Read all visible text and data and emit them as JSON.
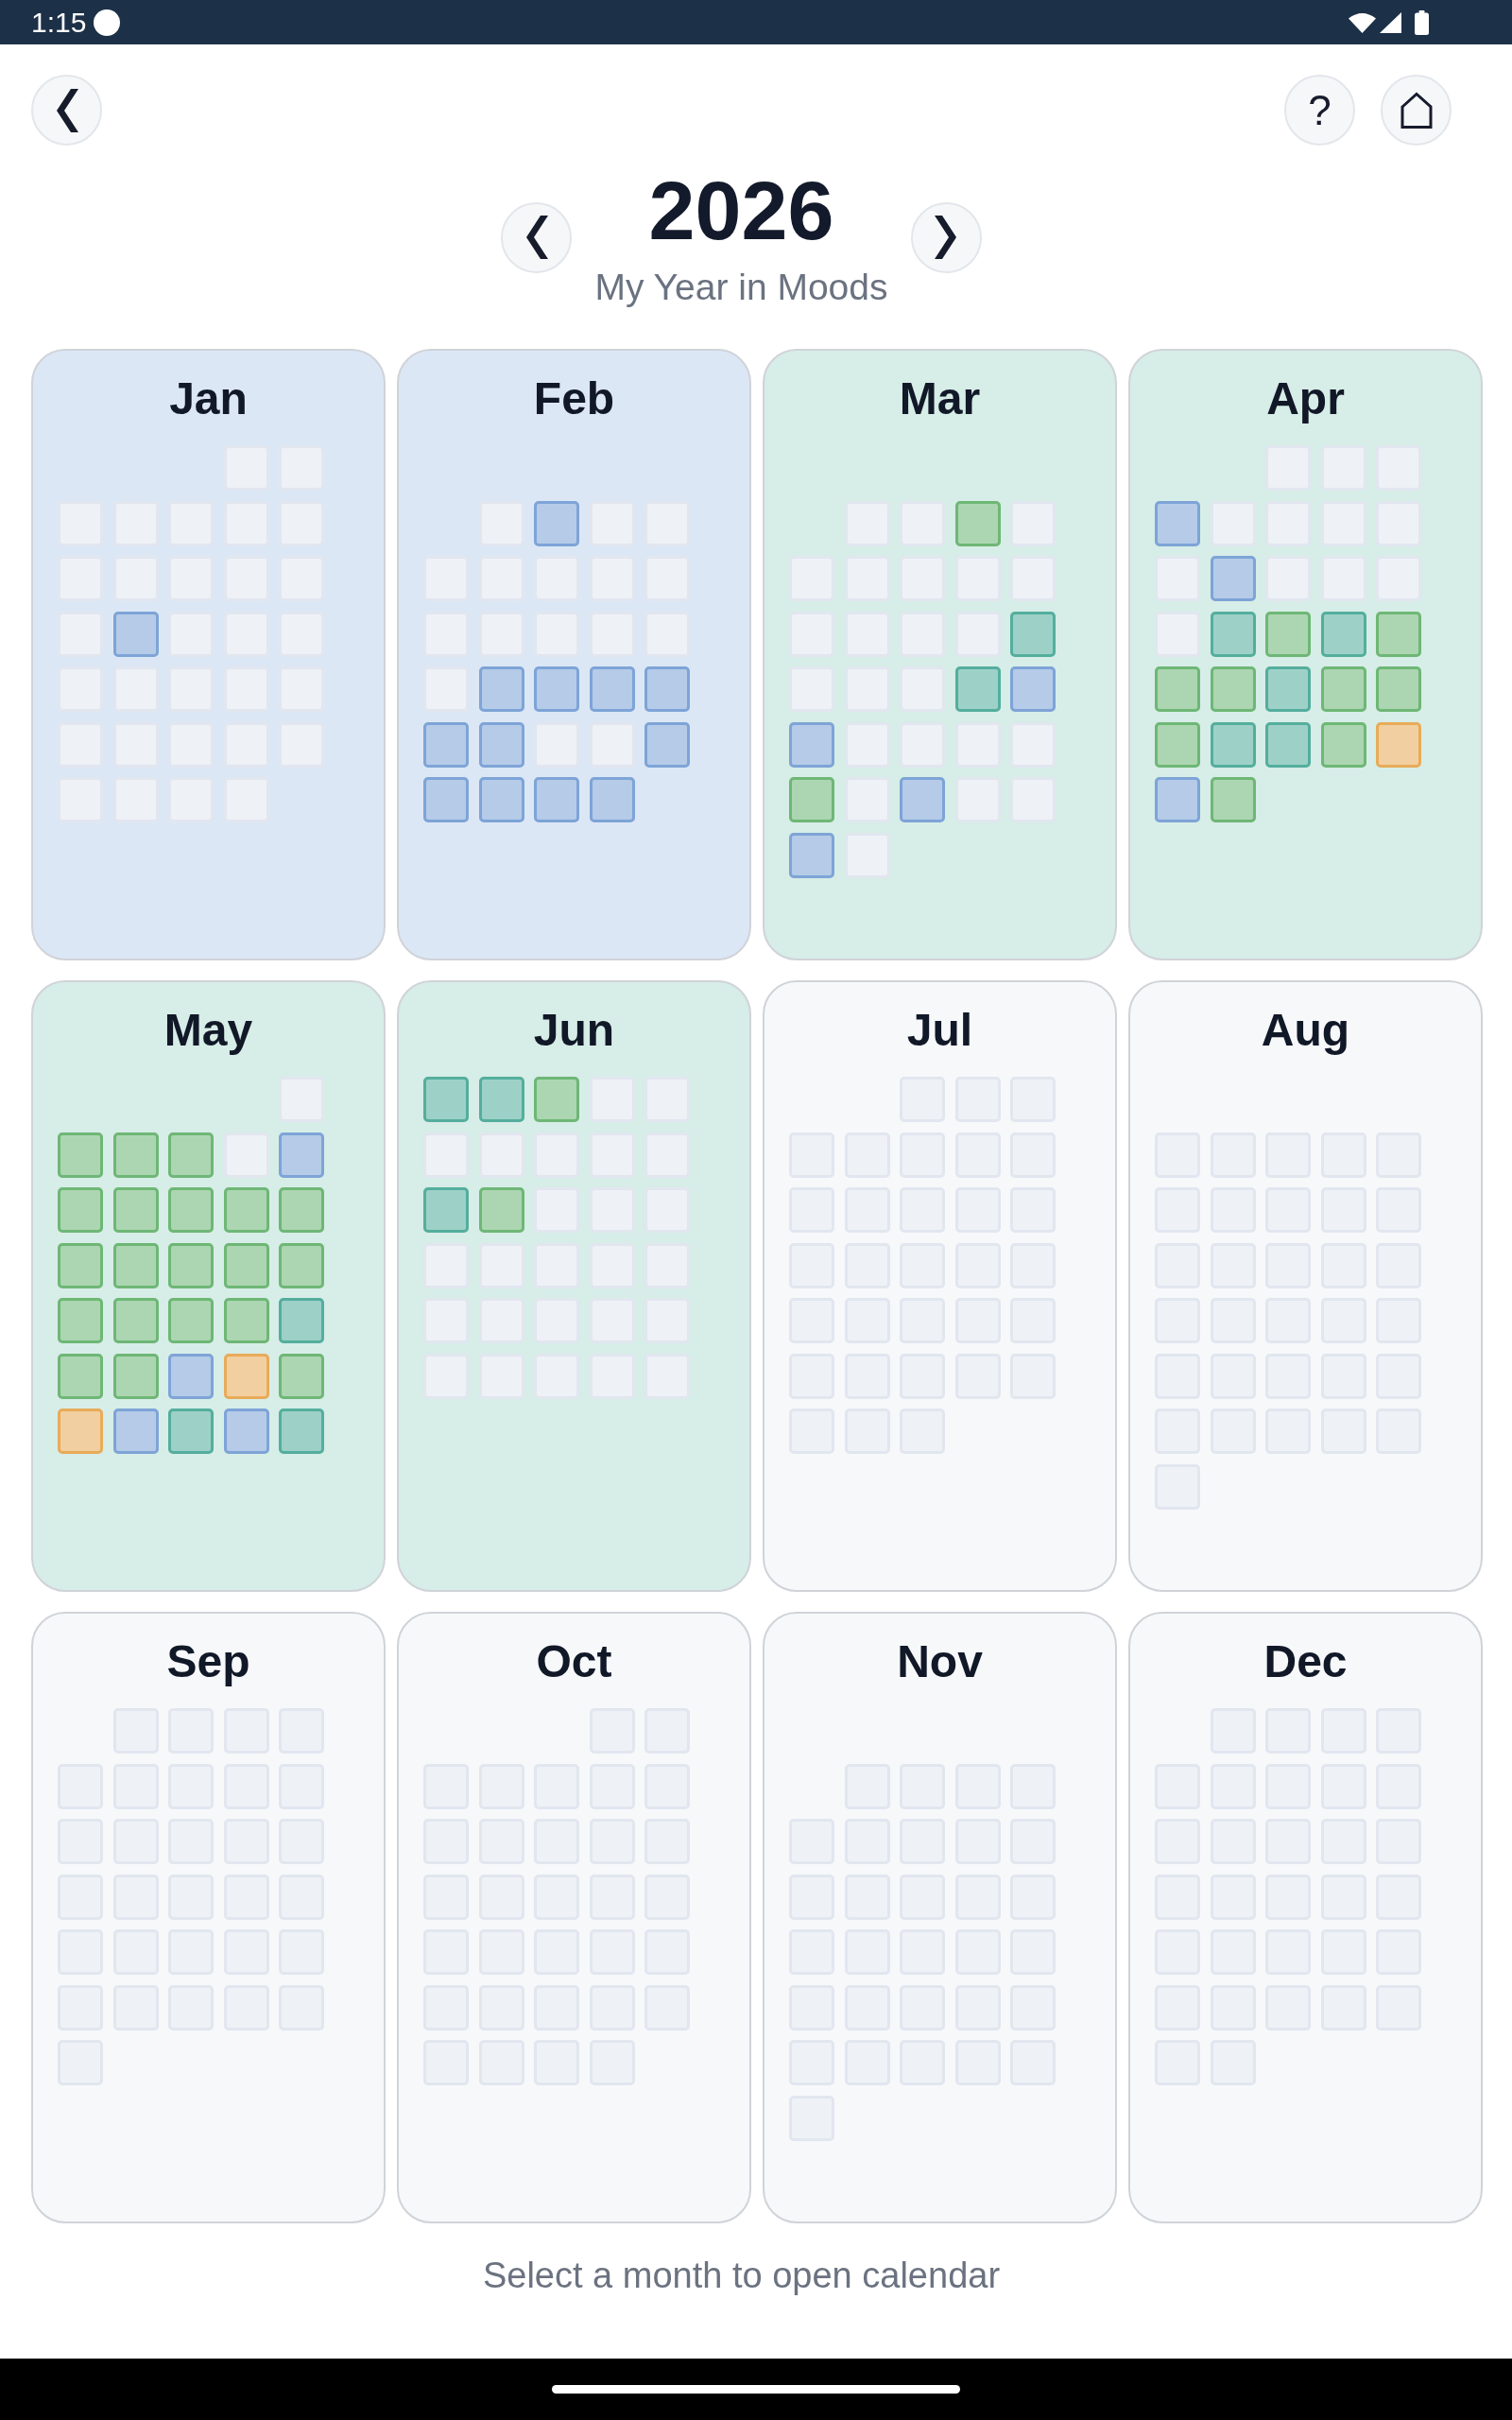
{
  "status_bar": {
    "time": "1:15"
  },
  "top_bar": {
    "help_button": "?"
  },
  "year_selector": {
    "year": "2026",
    "subtitle": "My Year in Moods"
  },
  "months": [
    {
      "name": "Jan",
      "color": "#dce7f6",
      "rows": [
        [
          null,
          null,
          null,
          {
            "color": "#eef1f6"
          },
          {
            "color": "#eef1f6"
          }
        ],
        [
          {
            "color": "#eef1f6"
          },
          {
            "color": "#eef1f6"
          },
          {
            "color": "#eef1f6"
          },
          {
            "color": "#eef1f6"
          },
          {
            "color": "#eef1f6"
          }
        ],
        [
          {
            "color": "#eef1f6"
          },
          {
            "color": "#eef1f6"
          },
          {
            "color": "#eef1f6"
          },
          {
            "color": "#eef1f6"
          },
          {
            "color": "#eef1f6"
          }
        ],
        [
          {
            "color": "#eef1f6"
          },
          {
            "color": "#b5cbe8"
          },
          {
            "color": "#eef1f6"
          },
          {
            "color": "#eef1f6"
          },
          {
            "color": "#eef1f6"
          }
        ],
        [
          {
            "color": "#eef1f6"
          },
          {
            "color": "#eef1f6"
          },
          {
            "color": "#eef1f6"
          },
          {
            "color": "#eef1f6"
          },
          {
            "color": "#eef1f6"
          }
        ],
        [
          {
            "color": "#eef1f6"
          },
          {
            "color": "#eef1f6"
          },
          {
            "color": "#eef1f6"
          },
          {
            "color": "#eef1f6"
          },
          {
            "color": "#eef1f6"
          }
        ],
        [
          {
            "color": "#eef1f6"
          },
          {
            "color": "#eef1f6"
          },
          {
            "color": "#eef1f6"
          },
          {
            "color": "#eef1f6"
          }
        ]
      ]
    },
    {
      "name": "Feb",
      "color": "#dce7f6",
      "rows": [
        [
          null,
          null,
          null,
          null,
          null
        ],
        [
          null,
          {
            "color": "#eef1f6"
          },
          {
            "color": "#b5cbe8"
          },
          {
            "color": "#eef1f6"
          },
          {
            "color": "#eef1f6"
          }
        ],
        [
          {
            "color": "#eef1f6"
          },
          {
            "color": "#eef1f6"
          },
          {
            "color": "#eef1f6"
          },
          {
            "color": "#eef1f6"
          },
          {
            "color": "#eef1f6"
          }
        ],
        [
          {
            "color": "#eef1f6"
          },
          {
            "color": "#eef1f6"
          },
          {
            "color": "#eef1f6"
          },
          {
            "color": "#eef1f6"
          },
          {
            "color": "#eef1f6"
          }
        ],
        [
          {
            "color": "#eef1f6"
          },
          {
            "color": "#b5cbe8"
          },
          {
            "color": "#b5cbe8"
          },
          {
            "color": "#b5cbe8"
          },
          {
            "color": "#b5cbe8"
          }
        ],
        [
          {
            "color": "#b5cbe8"
          },
          {
            "color": "#b5cbe8"
          },
          {
            "color": "#eef1f6"
          },
          {
            "color": "#eef1f6"
          },
          {
            "color": "#b5cbe8"
          }
        ],
        [
          {
            "color": "#b5cbe8"
          },
          {
            "color": "#b5cbe8"
          },
          {
            "color": "#b5cbe8"
          },
          {
            "color": "#b5cbe8"
          }
        ]
      ]
    },
    {
      "name": "Mar",
      "color": "#d7ede7",
      "rows": [
        [
          null,
          null,
          null,
          null,
          null
        ],
        [
          null,
          {
            "color": "#eef1f6"
          },
          {
            "color": "#eef1f6"
          },
          {
            "color": "#acd6b1"
          },
          {
            "color": "#eef1f6"
          }
        ],
        [
          {
            "color": "#eef1f6"
          },
          {
            "color": "#eef1f6"
          },
          {
            "color": "#eef1f6"
          },
          {
            "color": "#eef1f6"
          },
          {
            "color": "#eef1f6"
          }
        ],
        [
          {
            "color": "#eef1f6"
          },
          {
            "color": "#eef1f6"
          },
          {
            "color": "#eef1f6"
          },
          {
            "color": "#eef1f6"
          },
          {
            "color": "#9dd1c7"
          }
        ],
        [
          {
            "color": "#eef1f6"
          },
          {
            "color": "#eef1f6"
          },
          {
            "color": "#eef1f6"
          },
          {
            "color": "#9dd1c7"
          },
          {
            "color": "#b5cbe8"
          }
        ],
        [
          {
            "color": "#b5cbe8"
          },
          {
            "color": "#eef1f6"
          },
          {
            "color": "#eef1f6"
          },
          {
            "color": "#eef1f6"
          },
          {
            "color": "#eef1f6"
          }
        ],
        [
          {
            "color": "#acd6b1"
          },
          {
            "color": "#eef1f6"
          },
          {
            "color": "#b5cbe8"
          },
          {
            "color": "#eef1f6"
          },
          {
            "color": "#eef1f6"
          }
        ],
        [
          {
            "color": "#b5cbe8"
          },
          {
            "color": "#eef1f6"
          }
        ]
      ]
    },
    {
      "name": "Apr",
      "color": "#d7ede7",
      "rows": [
        [
          null,
          null,
          {
            "color": "#eef1f6"
          },
          {
            "color": "#eef1f6"
          },
          {
            "color": "#eef1f6"
          }
        ],
        [
          {
            "color": "#b5cbe8"
          },
          {
            "color": "#eef1f6"
          },
          {
            "color": "#eef1f6"
          },
          {
            "color": "#eef1f6"
          },
          {
            "color": "#eef1f6"
          }
        ],
        [
          {
            "color": "#eef1f6"
          },
          {
            "color": "#b5cbe8"
          },
          {
            "color": "#eef1f6"
          },
          {
            "color": "#eef1f6"
          },
          {
            "color": "#eef1f6"
          }
        ],
        [
          {
            "color": "#eef1f6"
          },
          {
            "color": "#9dd1c7"
          },
          {
            "color": "#acd6b1"
          },
          {
            "color": "#9dd1c7"
          },
          {
            "color": "#acd6b1"
          }
        ],
        [
          {
            "color": "#acd6b1"
          },
          {
            "color": "#acd6b1"
          },
          {
            "color": "#9dd1c7"
          },
          {
            "color": "#acd6b1"
          },
          {
            "color": "#acd6b1"
          }
        ],
        [
          {
            "color": "#acd6b1"
          },
          {
            "color": "#9dd1c7"
          },
          {
            "color": "#9dd1c7"
          },
          {
            "color": "#acd6b1"
          },
          {
            "color": "#f2cfa0"
          }
        ],
        [
          {
            "color": "#b5cbe8"
          },
          {
            "color": "#acd6b1"
          }
        ]
      ]
    },
    {
      "name": "May",
      "color": "#d7ede7",
      "rows": [
        [
          null,
          null,
          null,
          null,
          {
            "color": "#eef1f6"
          }
        ],
        [
          {
            "color": "#acd6b1"
          },
          {
            "color": "#acd6b1"
          },
          {
            "color": "#acd6b1"
          },
          {
            "color": "#eef1f6"
          },
          {
            "color": "#b5cbe8"
          }
        ],
        [
          {
            "color": "#acd6b1"
          },
          {
            "color": "#acd6b1"
          },
          {
            "color": "#acd6b1"
          },
          {
            "color": "#acd6b1"
          },
          {
            "color": "#acd6b1"
          }
        ],
        [
          {
            "color": "#acd6b1"
          },
          {
            "color": "#acd6b1"
          },
          {
            "color": "#acd6b1"
          },
          {
            "color": "#acd6b1"
          },
          {
            "color": "#acd6b1"
          }
        ],
        [
          {
            "color": "#acd6b1"
          },
          {
            "color": "#acd6b1"
          },
          {
            "color": "#acd6b1"
          },
          {
            "color": "#acd6b1"
          },
          {
            "color": "#9dd1c7"
          }
        ],
        [
          {
            "color": "#acd6b1"
          },
          {
            "color": "#acd6b1"
          },
          {
            "color": "#b5cbe8"
          },
          {
            "color": "#f2cfa0"
          },
          {
            "color": "#acd6b1"
          }
        ],
        [
          {
            "color": "#f2cfa0"
          },
          {
            "color": "#b5cbe8"
          },
          {
            "color": "#9dd1c7"
          },
          {
            "color": "#b5cbe8"
          },
          {
            "color": "#9dd1c7"
          }
        ]
      ]
    },
    {
      "name": "Jun",
      "color": "#d7ede7",
      "rows": [
        [
          {
            "color": "#9dd1c7"
          },
          {
            "color": "#9dd1c7"
          },
          {
            "color": "#acd6b1"
          },
          {
            "color": "#eef1f6"
          },
          {
            "color": "#eef1f6"
          }
        ],
        [
          {
            "color": "#eef1f6"
          },
          {
            "color": "#eef1f6"
          },
          {
            "color": "#eef1f6"
          },
          {
            "color": "#eef1f6"
          },
          {
            "color": "#eef1f6"
          }
        ],
        [
          {
            "color": "#9dd1c7"
          },
          {
            "color": "#acd6b1"
          },
          {
            "color": "#eef1f6"
          },
          {
            "color": "#eef1f6"
          },
          {
            "color": "#eef1f6"
          }
        ],
        [
          {
            "color": "#eef1f6"
          },
          {
            "color": "#eef1f6"
          },
          {
            "color": "#eef1f6"
          },
          {
            "color": "#eef1f6"
          },
          {
            "color": "#eef1f6"
          }
        ],
        [
          {
            "color": "#eef1f6"
          },
          {
            "color": "#eef1f6"
          },
          {
            "color": "#eef1f6"
          },
          {
            "color": "#eef1f6"
          },
          {
            "color": "#eef1f6"
          }
        ],
        [
          {
            "color": "#eef1f6"
          },
          {
            "color": "#eef1f6"
          },
          {
            "color": "#eef1f6"
          },
          {
            "color": "#eef1f6"
          },
          {
            "color": "#eef1f6"
          }
        ]
      ]
    },
    {
      "name": "Jul",
      "color": "#f7f8fa",
      "rows": [
        [
          null,
          null,
          {
            "color": "#eef1f6"
          },
          {
            "color": "#eef1f6"
          },
          {
            "color": "#eef1f6"
          }
        ],
        [
          {
            "color": "#eef1f6"
          },
          {
            "color": "#eef1f6"
          },
          {
            "color": "#eef1f6"
          },
          {
            "color": "#eef1f6"
          },
          {
            "color": "#eef1f6"
          }
        ],
        [
          {
            "color": "#eef1f6"
          },
          {
            "color": "#eef1f6"
          },
          {
            "color": "#eef1f6"
          },
          {
            "color": "#eef1f6"
          },
          {
            "color": "#eef1f6"
          }
        ],
        [
          {
            "color": "#eef1f6"
          },
          {
            "color": "#eef1f6"
          },
          {
            "color": "#eef1f6"
          },
          {
            "color": "#eef1f6"
          },
          {
            "color": "#eef1f6"
          }
        ],
        [
          {
            "color": "#eef1f6"
          },
          {
            "color": "#eef1f6"
          },
          {
            "color": "#eef1f6"
          },
          {
            "color": "#eef1f6"
          },
          {
            "color": "#eef1f6"
          }
        ],
        [
          {
            "color": "#eef1f6"
          },
          {
            "color": "#eef1f6"
          },
          {
            "color": "#eef1f6"
          },
          {
            "color": "#eef1f6"
          },
          {
            "color": "#eef1f6"
          }
        ],
        [
          {
            "color": "#eef1f6"
          },
          {
            "color": "#eef1f6"
          },
          {
            "color": "#eef1f6"
          }
        ]
      ]
    },
    {
      "name": "Aug",
      "color": "#f7f8fa",
      "rows": [
        [
          null,
          null,
          null,
          null,
          null
        ],
        [
          {
            "color": "#eef1f6"
          },
          {
            "color": "#eef1f6"
          },
          {
            "color": "#eef1f6"
          },
          {
            "color": "#eef1f6"
          },
          {
            "color": "#eef1f6"
          }
        ],
        [
          {
            "color": "#eef1f6"
          },
          {
            "color": "#eef1f6"
          },
          {
            "color": "#eef1f6"
          },
          {
            "color": "#eef1f6"
          },
          {
            "color": "#eef1f6"
          }
        ],
        [
          {
            "color": "#eef1f6"
          },
          {
            "color": "#eef1f6"
          },
          {
            "color": "#eef1f6"
          },
          {
            "color": "#eef1f6"
          },
          {
            "color": "#eef1f6"
          }
        ],
        [
          {
            "color": "#eef1f6"
          },
          {
            "color": "#eef1f6"
          },
          {
            "color": "#eef1f6"
          },
          {
            "color": "#eef1f6"
          },
          {
            "color": "#eef1f6"
          }
        ],
        [
          {
            "color": "#eef1f6"
          },
          {
            "color": "#eef1f6"
          },
          {
            "color": "#eef1f6"
          },
          {
            "color": "#eef1f6"
          },
          {
            "color": "#eef1f6"
          }
        ],
        [
          {
            "color": "#eef1f6"
          },
          {
            "color": "#eef1f6"
          },
          {
            "color": "#eef1f6"
          },
          {
            "color": "#eef1f6"
          },
          {
            "color": "#eef1f6"
          }
        ],
        [
          {
            "color": "#eef1f6"
          }
        ]
      ]
    },
    {
      "name": "Sep",
      "color": "#f7f8fa",
      "rows": [
        [
          null,
          {
            "color": "#eef1f6"
          },
          {
            "color": "#eef1f6"
          },
          {
            "color": "#eef1f6"
          },
          {
            "color": "#eef1f6"
          }
        ],
        [
          {
            "color": "#eef1f6"
          },
          {
            "color": "#eef1f6"
          },
          {
            "color": "#eef1f6"
          },
          {
            "color": "#eef1f6"
          },
          {
            "color": "#eef1f6"
          }
        ],
        [
          {
            "color": "#eef1f6"
          },
          {
            "color": "#eef1f6"
          },
          {
            "color": "#eef1f6"
          },
          {
            "color": "#eef1f6"
          },
          {
            "color": "#eef1f6"
          }
        ],
        [
          {
            "color": "#eef1f6"
          },
          {
            "color": "#eef1f6"
          },
          {
            "color": "#eef1f6"
          },
          {
            "color": "#eef1f6"
          },
          {
            "color": "#eef1f6"
          }
        ],
        [
          {
            "color": "#eef1f6"
          },
          {
            "color": "#eef1f6"
          },
          {
            "color": "#eef1f6"
          },
          {
            "color": "#eef1f6"
          },
          {
            "color": "#eef1f6"
          }
        ],
        [
          {
            "color": "#eef1f6"
          },
          {
            "color": "#eef1f6"
          },
          {
            "color": "#eef1f6"
          },
          {
            "color": "#eef1f6"
          },
          {
            "color": "#eef1f6"
          }
        ],
        [
          {
            "color": "#eef1f6"
          }
        ]
      ]
    },
    {
      "name": "Oct",
      "color": "#f7f8fa",
      "rows": [
        [
          null,
          null,
          null,
          {
            "color": "#eef1f6"
          },
          {
            "color": "#eef1f6"
          }
        ],
        [
          {
            "color": "#eef1f6"
          },
          {
            "color": "#eef1f6"
          },
          {
            "color": "#eef1f6"
          },
          {
            "color": "#eef1f6"
          },
          {
            "color": "#eef1f6"
          }
        ],
        [
          {
            "color": "#eef1f6"
          },
          {
            "color": "#eef1f6"
          },
          {
            "color": "#eef1f6"
          },
          {
            "color": "#eef1f6"
          },
          {
            "color": "#eef1f6"
          }
        ],
        [
          {
            "color": "#eef1f6"
          },
          {
            "color": "#eef1f6"
          },
          {
            "color": "#eef1f6"
          },
          {
            "color": "#eef1f6"
          },
          {
            "color": "#eef1f6"
          }
        ],
        [
          {
            "color": "#eef1f6"
          },
          {
            "color": "#eef1f6"
          },
          {
            "color": "#eef1f6"
          },
          {
            "color": "#eef1f6"
          },
          {
            "color": "#eef1f6"
          }
        ],
        [
          {
            "color": "#eef1f6"
          },
          {
            "color": "#eef1f6"
          },
          {
            "color": "#eef1f6"
          },
          {
            "color": "#eef1f6"
          },
          {
            "color": "#eef1f6"
          }
        ],
        [
          {
            "color": "#eef1f6"
          },
          {
            "color": "#eef1f6"
          },
          {
            "color": "#eef1f6"
          },
          {
            "color": "#eef1f6"
          }
        ]
      ]
    },
    {
      "name": "Nov",
      "color": "#f7f8fa",
      "rows": [
        [
          null,
          null,
          null,
          null,
          null
        ],
        [
          null,
          {
            "color": "#eef1f6"
          },
          {
            "color": "#eef1f6"
          },
          {
            "color": "#eef1f6"
          },
          {
            "color": "#eef1f6"
          }
        ],
        [
          {
            "color": "#eef1f6"
          },
          {
            "color": "#eef1f6"
          },
          {
            "color": "#eef1f6"
          },
          {
            "color": "#eef1f6"
          },
          {
            "color": "#eef1f6"
          }
        ],
        [
          {
            "color": "#eef1f6"
          },
          {
            "color": "#eef1f6"
          },
          {
            "color": "#eef1f6"
          },
          {
            "color": "#eef1f6"
          },
          {
            "color": "#eef1f6"
          }
        ],
        [
          {
            "color": "#eef1f6"
          },
          {
            "color": "#eef1f6"
          },
          {
            "color": "#eef1f6"
          },
          {
            "color": "#eef1f6"
          },
          {
            "color": "#eef1f6"
          }
        ],
        [
          {
            "color": "#eef1f6"
          },
          {
            "color": "#eef1f6"
          },
          {
            "color": "#eef1f6"
          },
          {
            "color": "#eef1f6"
          },
          {
            "color": "#eef1f6"
          }
        ],
        [
          {
            "color": "#eef1f6"
          },
          {
            "color": "#eef1f6"
          },
          {
            "color": "#eef1f6"
          },
          {
            "color": "#eef1f6"
          },
          {
            "color": "#eef1f6"
          }
        ],
        [
          {
            "color": "#eef1f6"
          }
        ]
      ]
    },
    {
      "name": "Dec",
      "color": "#f7f8fa",
      "rows": [
        [
          null,
          {
            "color": "#eef1f6"
          },
          {
            "color": "#eef1f6"
          },
          {
            "color": "#eef1f6"
          },
          {
            "color": "#eef1f6"
          }
        ],
        [
          {
            "color": "#eef1f6"
          },
          {
            "color": "#eef1f6"
          },
          {
            "color": "#eef1f6"
          },
          {
            "color": "#eef1f6"
          },
          {
            "color": "#eef1f6"
          }
        ],
        [
          {
            "color": "#eef1f6"
          },
          {
            "color": "#eef1f6"
          },
          {
            "color": "#eef1f6"
          },
          {
            "color": "#eef1f6"
          },
          {
            "color": "#eef1f6"
          }
        ],
        [
          {
            "color": "#eef1f6"
          },
          {
            "color": "#eef1f6"
          },
          {
            "color": "#eef1f6"
          },
          {
            "color": "#eef1f6"
          },
          {
            "color": "#eef1f6"
          }
        ],
        [
          {
            "color": "#eef1f6"
          },
          {
            "color": "#eef1f6"
          },
          {
            "color": "#eef1f6"
          },
          {
            "color": "#eef1f6"
          },
          {
            "color": "#eef1f6"
          }
        ],
        [
          {
            "color": "#eef1f6"
          },
          {
            "color": "#eef1f6"
          },
          {
            "color": "#eef1f6"
          },
          {
            "color": "#eef1f6"
          },
          {
            "color": "#eef1f6"
          }
        ],
        [
          {
            "color": "#eef1f6"
          },
          {
            "color": "#eef1f6"
          }
        ]
      ]
    }
  ],
  "footer_hint": "Select a month to open calendar"
}
